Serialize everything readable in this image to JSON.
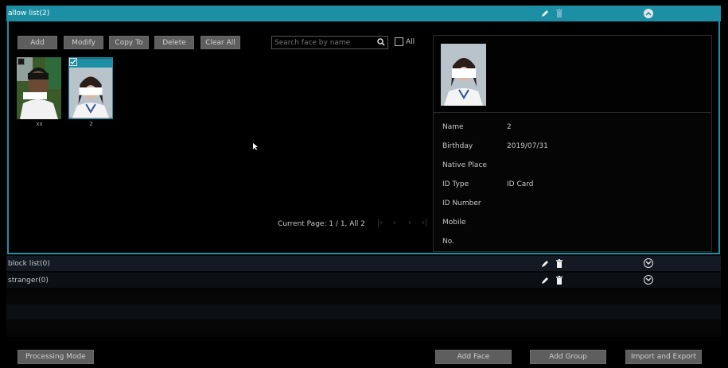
{
  "groups": [
    {
      "title": "allow list(2)",
      "expanded": true
    },
    {
      "title": "block list(0)",
      "expanded": false
    },
    {
      "title": "stranger(0)",
      "expanded": false
    }
  ],
  "toolbar": {
    "add": "Add",
    "modify": "Modify",
    "copy_to": "Copy To",
    "delete": "Delete",
    "clear_all": "Clear All"
  },
  "search": {
    "placeholder": "Search face by name",
    "all_label": "All"
  },
  "faces": [
    {
      "name": "xx",
      "checked": false
    },
    {
      "name": "2",
      "checked": true
    }
  ],
  "pager": {
    "text": "Current Page: 1 / 1, All 2"
  },
  "details": {
    "fields": [
      {
        "label": "Name",
        "value": "2"
      },
      {
        "label": "Birthday",
        "value": "2019/07/31"
      },
      {
        "label": "Native Place",
        "value": ""
      },
      {
        "label": "ID Type",
        "value": "ID Card"
      },
      {
        "label": "ID Number",
        "value": ""
      },
      {
        "label": "Mobile",
        "value": ""
      },
      {
        "label": "No.",
        "value": ""
      }
    ]
  },
  "footer": {
    "processing_mode": "Processing Mode",
    "add_face": "Add Face",
    "add_group": "Add Group",
    "import_export": "Import and Export"
  },
  "colors": {
    "accent": "#1c8fa5",
    "panel": "#111111",
    "button": "#5e5e5e"
  }
}
